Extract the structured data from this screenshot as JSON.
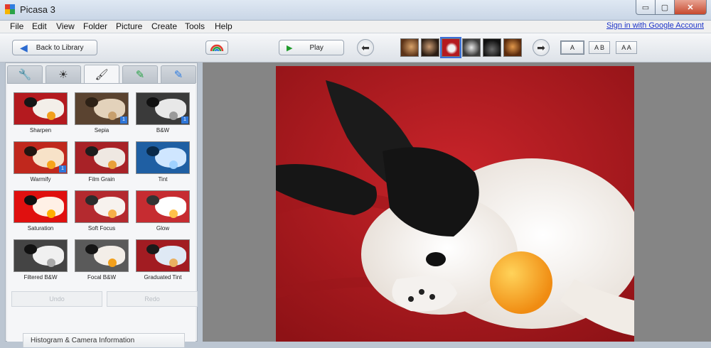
{
  "window": {
    "title": "Picasa 3",
    "minimize_glyph": "▭",
    "maximize_glyph": "▢",
    "close_glyph": "✕"
  },
  "menu": {
    "items": [
      "File",
      "Edit",
      "View",
      "Folder",
      "Picture",
      "Create",
      "Tools",
      "Help"
    ],
    "sign_in": "Sign in with Google Account"
  },
  "toolbar": {
    "back_label": "Back to Library",
    "back_icon": "◀",
    "play_label": "Play",
    "play_icon": "▶",
    "prev_icon": "⬅",
    "next_icon": "➡",
    "view_buttons": [
      "A",
      "A B",
      "A A"
    ]
  },
  "tabs": [
    {
      "name": "basic-fixes",
      "icon": "wrench-icon",
      "glyph": "🔧"
    },
    {
      "name": "tuning",
      "icon": "sun-icon",
      "glyph": "☀"
    },
    {
      "name": "effects",
      "icon": "brush-icon",
      "glyph": "🖌"
    },
    {
      "name": "effects-2",
      "icon": "picture-brush-icon",
      "glyph": "✎"
    },
    {
      "name": "effects-3",
      "icon": "picture-edit-icon",
      "glyph": "✎"
    }
  ],
  "effects": [
    {
      "label": "Sharpen",
      "badge": ""
    },
    {
      "label": "Sepia",
      "badge": "1"
    },
    {
      "label": "B&W",
      "badge": "1"
    },
    {
      "label": "Warmify",
      "badge": "1"
    },
    {
      "label": "Film Grain",
      "badge": ""
    },
    {
      "label": "Tint",
      "badge": ""
    },
    {
      "label": "Saturation",
      "badge": ""
    },
    {
      "label": "Soft Focus",
      "badge": ""
    },
    {
      "label": "Glow",
      "badge": ""
    },
    {
      "label": "Filtered B&W",
      "badge": ""
    },
    {
      "label": "Focal B&W",
      "badge": ""
    },
    {
      "label": "Graduated Tint",
      "badge": ""
    }
  ],
  "actions": {
    "undo": "Undo",
    "redo": "Redo"
  },
  "histogram_label": "Histogram & Camera Information",
  "colors": {
    "accent": "#2b6ad0",
    "photo_bg": "#b41a1f",
    "viewer_bg": "#858585"
  }
}
